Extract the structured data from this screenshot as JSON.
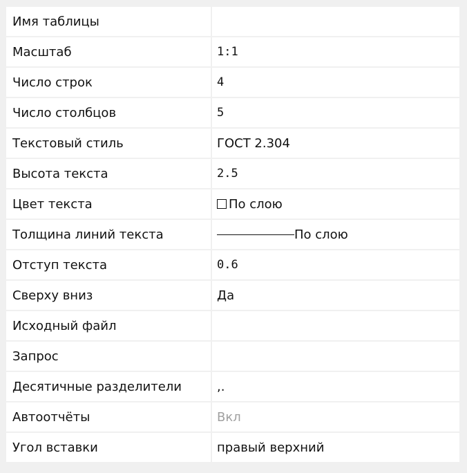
{
  "properties": [
    {
      "name": "Имя таблицы",
      "value": ""
    },
    {
      "name": "Масштаб",
      "value": "1:1"
    },
    {
      "name": "Число строк",
      "value": "4"
    },
    {
      "name": "Число столбцов",
      "value": "5"
    },
    {
      "name": "Текстовый стиль",
      "value": "ГОСТ 2.304"
    },
    {
      "name": "Высота текста",
      "value": "2.5"
    },
    {
      "name": "Цвет текста",
      "value": "По слою",
      "swatch_color": "#ffffff"
    },
    {
      "name": "Толщина линий текста",
      "value": "По слою"
    },
    {
      "name": "Отступ текста",
      "value": "0.6"
    },
    {
      "name": "Сверху вниз",
      "value": "Да"
    },
    {
      "name": "Исходный файл",
      "value": ""
    },
    {
      "name": "Запрос",
      "value": ""
    },
    {
      "name": "Десятичные разделители",
      "value": ",."
    },
    {
      "name": "Автоотчёты",
      "value": "Вкл",
      "disabled": true
    },
    {
      "name": "Угол вставки",
      "value": "правый верхний"
    }
  ]
}
